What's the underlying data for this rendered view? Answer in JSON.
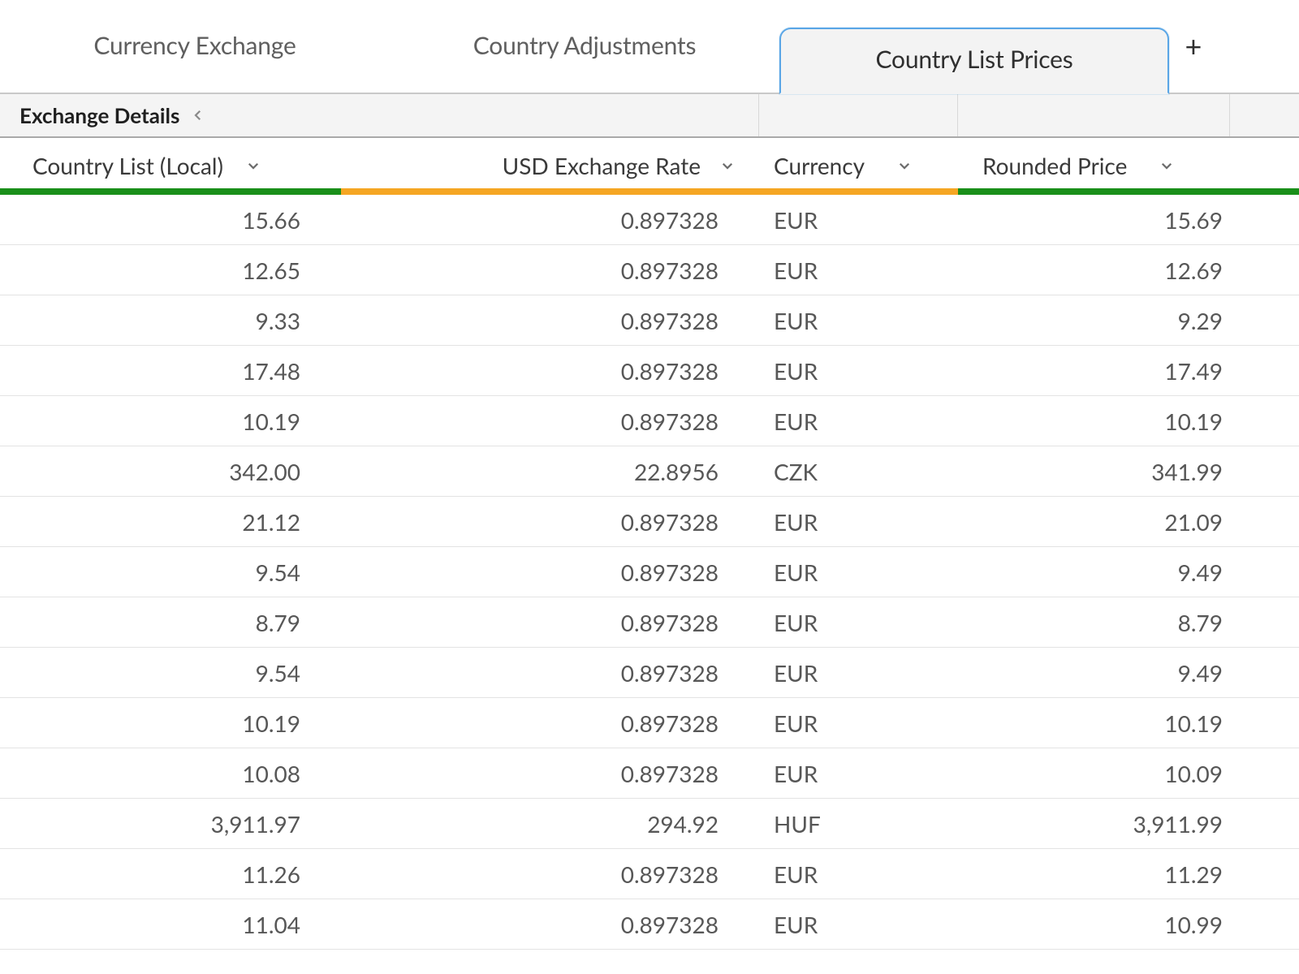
{
  "tabs": {
    "items": [
      {
        "label": "Currency Exchange"
      },
      {
        "label": "Country Adjustments"
      },
      {
        "label": "Country List Prices"
      }
    ],
    "add_label": "+"
  },
  "breadcrumb": {
    "title": "Exchange Details"
  },
  "columns": {
    "local": "Country List (Local)",
    "rate": "USD Exchange Rate",
    "curr": "Currency",
    "rounded": "Rounded Price"
  },
  "colors": {
    "accent_green": "#1a8f1a",
    "accent_orange": "#f5a623",
    "tab_active_border": "#5aa6e6"
  },
  "rows": [
    {
      "local": "15.66",
      "rate": "0.897328",
      "curr": "EUR",
      "rounded": "15.69"
    },
    {
      "local": "12.65",
      "rate": "0.897328",
      "curr": "EUR",
      "rounded": "12.69"
    },
    {
      "local": "9.33",
      "rate": "0.897328",
      "curr": "EUR",
      "rounded": "9.29"
    },
    {
      "local": "17.48",
      "rate": "0.897328",
      "curr": "EUR",
      "rounded": "17.49"
    },
    {
      "local": "10.19",
      "rate": "0.897328",
      "curr": "EUR",
      "rounded": "10.19"
    },
    {
      "local": "342.00",
      "rate": "22.8956",
      "curr": "CZK",
      "rounded": "341.99"
    },
    {
      "local": "21.12",
      "rate": "0.897328",
      "curr": "EUR",
      "rounded": "21.09"
    },
    {
      "local": "9.54",
      "rate": "0.897328",
      "curr": "EUR",
      "rounded": "9.49"
    },
    {
      "local": "8.79",
      "rate": "0.897328",
      "curr": "EUR",
      "rounded": "8.79"
    },
    {
      "local": "9.54",
      "rate": "0.897328",
      "curr": "EUR",
      "rounded": "9.49"
    },
    {
      "local": "10.19",
      "rate": "0.897328",
      "curr": "EUR",
      "rounded": "10.19"
    },
    {
      "local": "10.08",
      "rate": "0.897328",
      "curr": "EUR",
      "rounded": "10.09"
    },
    {
      "local": "3,911.97",
      "rate": "294.92",
      "curr": "HUF",
      "rounded": "3,911.99"
    },
    {
      "local": "11.26",
      "rate": "0.897328",
      "curr": "EUR",
      "rounded": "11.29"
    },
    {
      "local": "11.04",
      "rate": "0.897328",
      "curr": "EUR",
      "rounded": "10.99"
    }
  ]
}
